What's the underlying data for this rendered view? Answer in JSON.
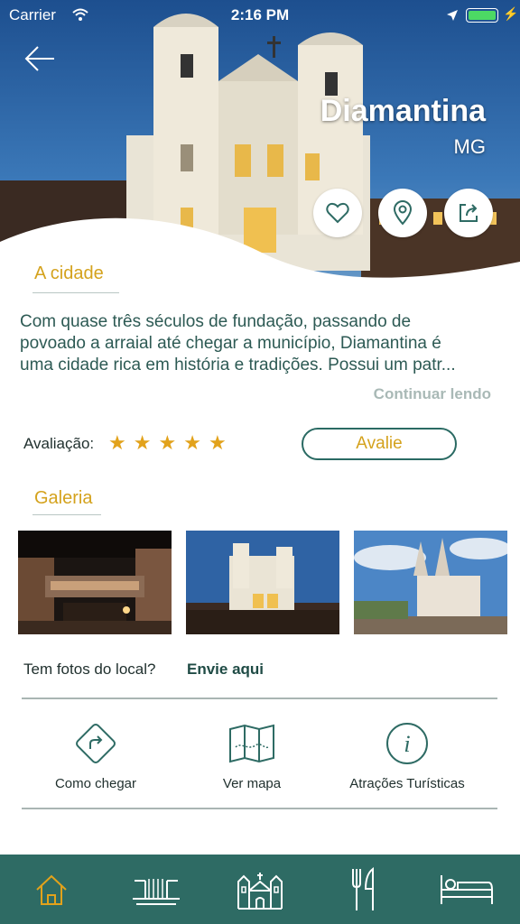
{
  "status_bar": {
    "carrier": "Carrier",
    "time": "2:16 PM",
    "battery_level": 1.0
  },
  "header": {
    "title": "Diamantina",
    "state": "MG",
    "back_icon": "arrow-left-icon",
    "buttons": [
      {
        "icon": "heart-icon"
      },
      {
        "icon": "map-pin-icon"
      },
      {
        "icon": "share-icon"
      }
    ]
  },
  "about": {
    "title": "A cidade",
    "lines": [
      "Com quase três séculos de fundação, passando de",
      "povoado a arraial até chegar a município, Diamantina é",
      "uma cidade rica em história e tradições. Possui um patr..."
    ],
    "continue_label": "Continuar lendo"
  },
  "rating": {
    "label": "Avaliação:",
    "stars": 5,
    "rate_button": "Avalie"
  },
  "gallery": {
    "title": "Galeria",
    "photos_prompt": "Tem fotos do local?",
    "send_link": "Envie aqui"
  },
  "actions": [
    {
      "label": "Como chegar",
      "icon": "directions-icon"
    },
    {
      "label": "Ver mapa",
      "icon": "map-icon"
    },
    {
      "label": "Atrações Turísticas",
      "icon": "info-icon"
    }
  ],
  "tabbar": {
    "tabs": [
      {
        "icon": "home-icon",
        "active": true
      },
      {
        "icon": "waterfall-icon",
        "active": false
      },
      {
        "icon": "church-icon",
        "active": false
      },
      {
        "icon": "restaurant-icon",
        "active": false
      },
      {
        "icon": "bed-icon",
        "active": false
      }
    ]
  },
  "colors": {
    "accent": "#d4a21d",
    "primary": "#2e6b64",
    "text": "#1f4b45"
  }
}
